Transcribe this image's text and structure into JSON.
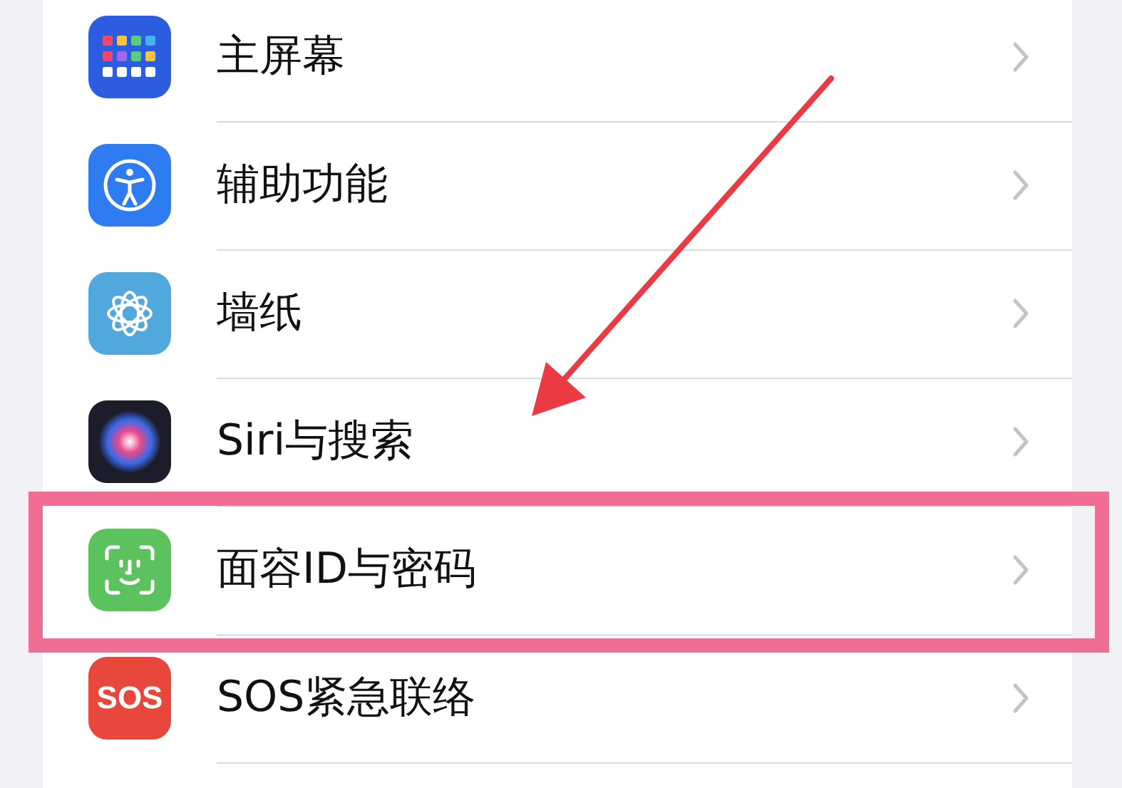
{
  "rows": [
    {
      "label": "主屏幕",
      "kind": "home",
      "highlighted": false
    },
    {
      "label": "辅助功能",
      "kind": "accessibility",
      "highlighted": false
    },
    {
      "label": "墙纸",
      "kind": "wallpaper",
      "highlighted": false
    },
    {
      "label": "Siri与搜索",
      "kind": "siri",
      "highlighted": false
    },
    {
      "label": "面容ID与密码",
      "kind": "faceid",
      "highlighted": true
    },
    {
      "label": "SOS紧急联络",
      "kind": "sos",
      "icon_text": "SOS",
      "highlighted": false
    }
  ]
}
